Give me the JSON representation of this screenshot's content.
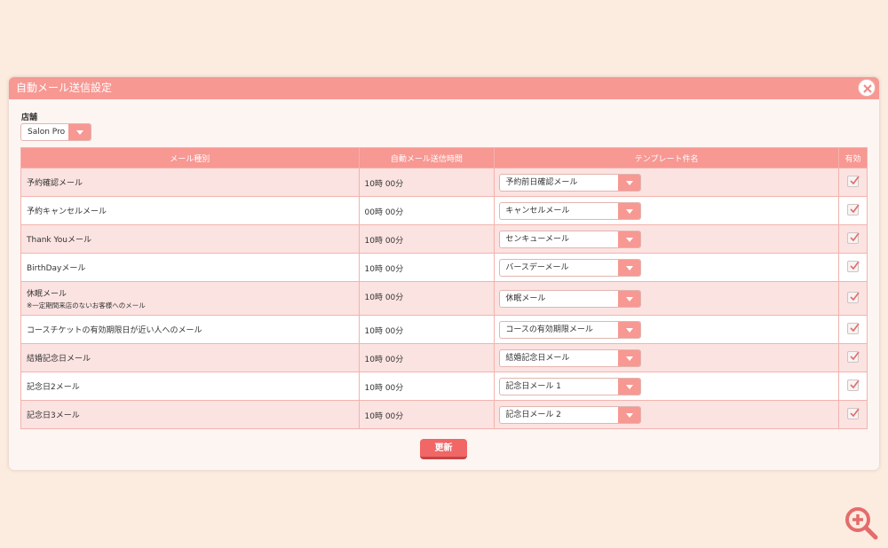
{
  "dialog": {
    "title": "自動メール送信設定"
  },
  "store": {
    "label": "店舗",
    "selected": "Salon Pro"
  },
  "table": {
    "headers": [
      "メール種別",
      "自動メール送信時間",
      "テンプレート件名",
      "有効"
    ],
    "rows": [
      {
        "type": "予約確認メール",
        "note": "",
        "time": "10時 00分",
        "template": "予約前日確認メール",
        "enabled": true
      },
      {
        "type": "予約キャンセルメール",
        "note": "",
        "time": "00時 00分",
        "template": "キャンセルメール",
        "enabled": true
      },
      {
        "type": "Thank Youメール",
        "note": "",
        "time": "10時 00分",
        "template": "センキューメール",
        "enabled": true
      },
      {
        "type": "BirthDayメール",
        "note": "",
        "time": "10時 00分",
        "template": "バースデーメール",
        "enabled": true
      },
      {
        "type": "休眠メール",
        "note": "※一定期間来店のないお客様へのメール",
        "time": "10時 00分",
        "template": "休眠メール",
        "enabled": true
      },
      {
        "type": "コースチケットの有効期限日が近い人へのメール",
        "note": "",
        "time": "10時 00分",
        "template": "コースの有効期限メール",
        "enabled": true
      },
      {
        "type": "結婚記念日メール",
        "note": "",
        "time": "10時 00分",
        "template": "結婚記念日メール",
        "enabled": true
      },
      {
        "type": "記念日2メール",
        "note": "",
        "time": "10時 00分",
        "template": "記念日メール 1",
        "enabled": true
      },
      {
        "type": "記念日3メール",
        "note": "",
        "time": "10時 00分",
        "template": "記念日メール 2",
        "enabled": true
      }
    ]
  },
  "actions": {
    "update_label": "更新"
  },
  "icons": {
    "close": "close-icon",
    "dropdown": "chevron-down-icon",
    "check": "checkmark-icon",
    "zoom": "zoom-in-icon"
  },
  "colors": {
    "background": "#fcebdf",
    "header": "#f79893",
    "accent_button": "#f06766",
    "row_alt": "#fbe3e1",
    "check": "#e46c6c"
  }
}
